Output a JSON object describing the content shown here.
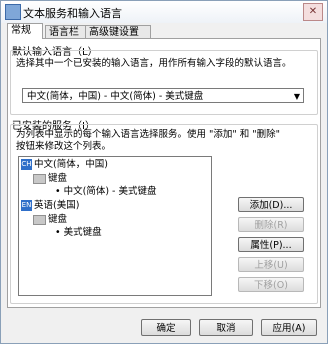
{
  "window": {
    "title": "文本服务和输入语言",
    "close_label": "✕"
  },
  "tabs": [
    {
      "label": "常规",
      "active": true
    },
    {
      "label": "语言栏",
      "active": false
    },
    {
      "label": "高级键设置",
      "active": false
    }
  ],
  "default_language": {
    "heading": "默认输入语言（L）",
    "description": "选择其中一个已安装的输入语言，用作所有输入字段的默认语言。",
    "selected": "中文(简体，中国) - 中文(简体) - 美式键盘"
  },
  "installed_services": {
    "heading": "已安装的服务（I）",
    "description_line1": "为列表中显示的每个输入语言选择服务。使用 \"添加\" 和 \"删除\"",
    "description_line2": "按钮来修改这个列表。",
    "tree": [
      {
        "type": "language",
        "badge": "CH",
        "label": "中文(简体，中国)"
      },
      {
        "type": "category",
        "label": "键盘"
      },
      {
        "type": "item",
        "label": "中文(简体) - 美式键盘"
      },
      {
        "type": "language",
        "badge": "EN",
        "label": "英语(美国)"
      },
      {
        "type": "category",
        "label": "键盘"
      },
      {
        "type": "item",
        "label": "美式键盘"
      }
    ]
  },
  "side_buttons": {
    "add": "添加(D)...",
    "remove": "删除(R)",
    "properties": "属性(P)...",
    "move_up": "上移(U)",
    "move_down": "下移(O)"
  },
  "footer": {
    "ok": "确定",
    "cancel": "取消",
    "apply": "应用(A)"
  }
}
